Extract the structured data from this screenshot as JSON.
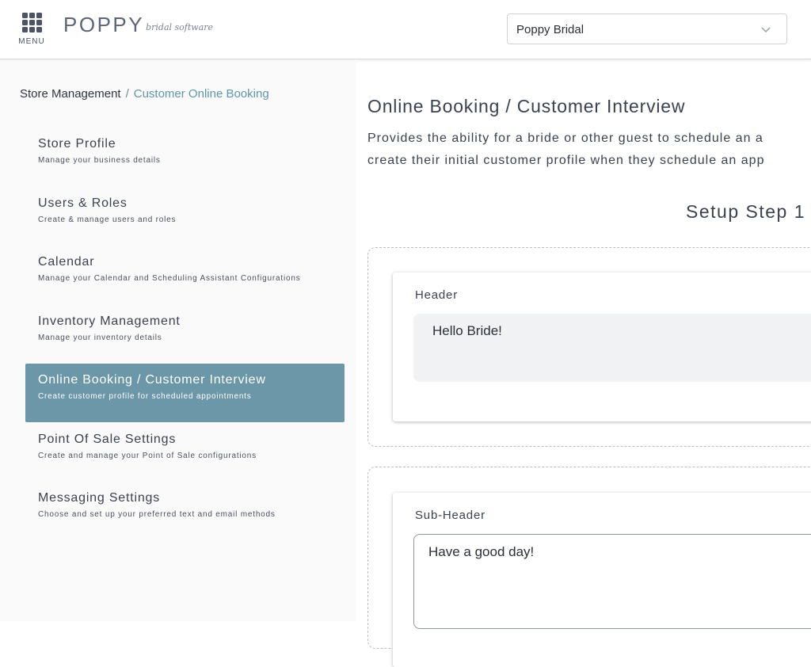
{
  "header": {
    "menu_label": "MENU",
    "logo_main": "POPPY",
    "logo_sub": "bridal software",
    "store_selected": "Poppy Bridal"
  },
  "breadcrumb": {
    "root": "Store Management",
    "separator": "/",
    "current": "Customer Online Booking"
  },
  "sidebar": {
    "items": [
      {
        "title": "Store Profile",
        "desc": "Manage your business details"
      },
      {
        "title": "Users & Roles",
        "desc": "Create & manage users and roles"
      },
      {
        "title": "Calendar",
        "desc": "Manage your Calendar and Scheduling Assistant Configurations"
      },
      {
        "title": "Inventory Management",
        "desc": "Manage your inventory details"
      },
      {
        "title": "Online Booking / Customer Interview",
        "desc": "Create customer profile for scheduled appointments"
      },
      {
        "title": "Point Of Sale Settings",
        "desc": "Create and manage your Point of Sale configurations"
      },
      {
        "title": "Messaging Settings",
        "desc": "Choose and set up your preferred text and email methods"
      }
    ],
    "active_index": 4
  },
  "main": {
    "title": "Online Booking / Customer Interview",
    "description_line1": "Provides the ability for a bride or other guest to schedule an a",
    "description_line2": "create their initial customer profile when they schedule an app",
    "step_title": "Setup Step 1",
    "header_card": {
      "label": "Header",
      "value": "Hello Bride!"
    },
    "subheader_card": {
      "label": "Sub-Header",
      "value": "Have a good day!"
    }
  },
  "colors": {
    "accent": "#6b97a8",
    "breadcrumb_current": "#5f96ab",
    "text": "#3a4252"
  }
}
